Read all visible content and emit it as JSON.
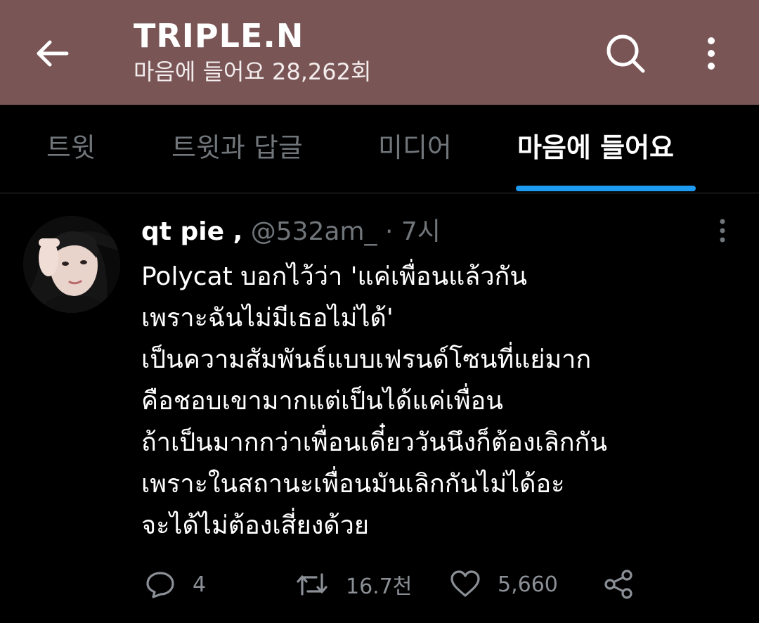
{
  "header": {
    "title": "TRIPLE.N",
    "subtitle": "마음에 들어요 28,262회"
  },
  "tabs": [
    {
      "label": "트윗"
    },
    {
      "label": "트윗과 답글"
    },
    {
      "label": "미디어"
    },
    {
      "label": "마음에 들어요",
      "active": true
    }
  ],
  "tweet": {
    "display_name": "qt pie ,",
    "handle": "@532am_",
    "separator": "·",
    "time": "7시",
    "text": "Polycat บอกไว้ว่า 'แค่เพื่อนแล้วกัน\nเพราะฉันไม่มีเธอไม่ได้'\nเป็นความสัมพันธ์แบบเฟรนด์โซนที่แย่มาก\nคือชอบเขามากแต่เป็นได้แค่เพื่อน\nถ้าเป็นมากกว่าเพื่อนเดี๋ยววันนึงก็ต้องเลิกกัน\nเพราะในสถานะเพื่อนมันเลิกกันไม่ได้อะ\nจะได้ไม่ต้องเสี่ยงด้วย",
    "replies": "4",
    "retweets": "16.7천",
    "likes": "5,660"
  },
  "colors": {
    "header_bg": "#7a5556",
    "accent": "#1d9bf0",
    "muted": "#71767b",
    "background": "#000000"
  },
  "icons": [
    "back-arrow-icon",
    "search-icon",
    "more-vertical-icon",
    "reply-icon",
    "retweet-icon",
    "like-icon",
    "share-icon"
  ]
}
